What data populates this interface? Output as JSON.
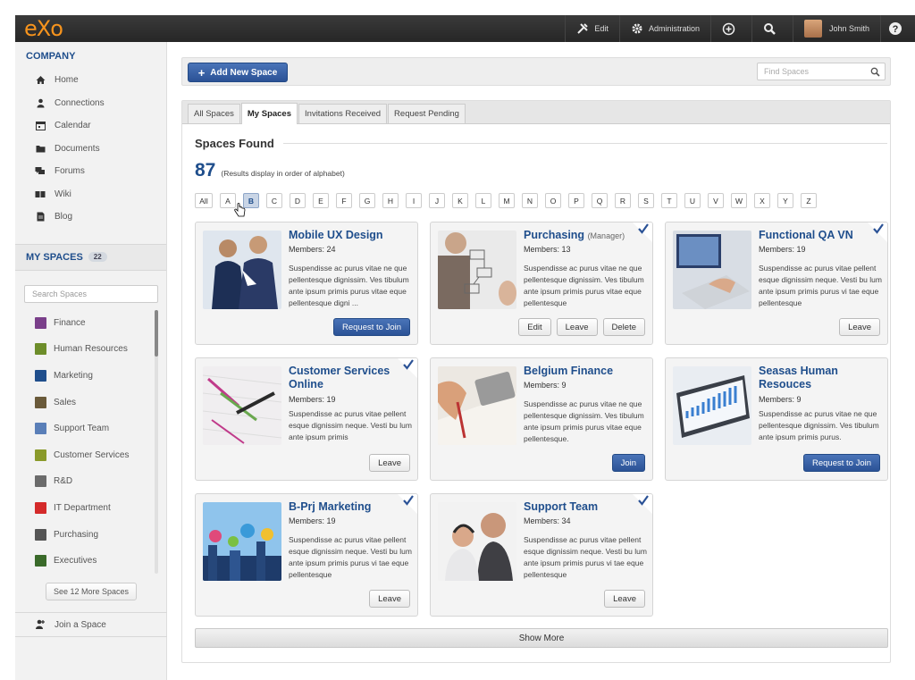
{
  "topbar": {
    "logo": "eXo",
    "edit_label": "Edit",
    "admin_label": "Administration",
    "user_name": "John Smith"
  },
  "sidebar": {
    "company_heading": "COMPANY",
    "nav_items": [
      {
        "label": "Home",
        "icon": "home-icon"
      },
      {
        "label": "Connections",
        "icon": "user-icon"
      },
      {
        "label": "Calendar",
        "icon": "calendar-icon"
      },
      {
        "label": "Documents",
        "icon": "folder-icon"
      },
      {
        "label": "Forums",
        "icon": "chat-icon"
      },
      {
        "label": "Wiki",
        "icon": "book-icon"
      },
      {
        "label": "Blog",
        "icon": "doc-icon"
      }
    ],
    "my_spaces_heading": "MY SPACES",
    "my_spaces_count": "22",
    "search_placeholder": "Search Spaces",
    "spaces": [
      {
        "label": "Finance",
        "color": "#7a3f8a"
      },
      {
        "label": "Human Resources",
        "color": "#6d8d2a"
      },
      {
        "label": "Marketing",
        "color": "#1f4e8c"
      },
      {
        "label": "Sales",
        "color": "#6a5a3a"
      },
      {
        "label": "Support Team",
        "color": "#5a7fb8"
      },
      {
        "label": "Customer Services",
        "color": "#8a9a2a"
      },
      {
        "label": "R&D",
        "color": "#6b6b6b"
      },
      {
        "label": "IT Department",
        "color": "#d42a2a"
      },
      {
        "label": "Purchasing",
        "color": "#555555"
      },
      {
        "label": "Executives",
        "color": "#3a6a2a"
      }
    ],
    "see_more_label": "See 12 More Spaces",
    "join_label": "Join a Space"
  },
  "actionbar": {
    "add_label": "Add New Space",
    "find_placeholder": "Find Spaces"
  },
  "tabs": [
    "All Spaces",
    "My Spaces",
    "Invitations Received",
    "Request Pending"
  ],
  "active_tab": "My Spaces",
  "found": {
    "heading": "Spaces Found",
    "count": "87",
    "note": "(Results display in order of alphabet)"
  },
  "letters": [
    "All",
    "A",
    "B",
    "C",
    "D",
    "E",
    "F",
    "G",
    "H",
    "I",
    "J",
    "K",
    "L",
    "M",
    "N",
    "O",
    "P",
    "Q",
    "R",
    "S",
    "T",
    "U",
    "V",
    "W",
    "X",
    "Y",
    "Z"
  ],
  "active_letter": "B",
  "cards": [
    {
      "title": "Mobile UX Design",
      "role": "",
      "members": "Members: 24",
      "desc": "Suspendisse ac purus vitae ne que pellentesque dignissim. Ves tibulum ante ipsum primis purus vitae eque pellentesque digni ...",
      "checked": false,
      "actions": [
        "Request to Join"
      ]
    },
    {
      "title": "Purchasing",
      "role": "(Manager)",
      "members": "Members: 13",
      "desc": "Suspendisse ac purus vitae ne que pellentesque dignissim. Ves tibulum ante ipsum primis purus vitae eque pellentesque",
      "checked": true,
      "actions": [
        "Edit",
        "Leave",
        "Delete"
      ]
    },
    {
      "title": "Functional QA VN",
      "role": "",
      "members": "Members: 19",
      "desc": "Suspendisse ac purus vitae pellent esque dignissim neque. Vesti bu lum ante ipsum primis purus vi tae eque pellentesque",
      "checked": true,
      "actions": [
        "Leave"
      ]
    },
    {
      "title": "Customer Services Online",
      "role": "",
      "members": "Members: 19",
      "desc": "Suspendisse ac purus vitae pellent esque dignissim neque. Vesti bu lum ante ipsum primis",
      "checked": true,
      "actions": [
        "Leave"
      ]
    },
    {
      "title": "Belgium Finance",
      "role": "",
      "members": "Members: 9",
      "desc": "Suspendisse ac purus vitae ne que pellentesque dignissim. Ves tibulum ante ipsum primis purus vitae eque pellentesque.",
      "checked": false,
      "actions": [
        "Join"
      ]
    },
    {
      "title": "Seasas Human Resouces",
      "role": "",
      "members": "Members: 9",
      "desc": "Suspendisse ac purus vitae ne que pellentesque dignissim. Ves tibulum ante ipsum primis purus.",
      "checked": false,
      "actions": [
        "Request to Join"
      ]
    },
    {
      "title": "B-Prj  Marketing",
      "role": "",
      "members": "Members: 19",
      "desc": "Suspendisse ac purus vitae pellent esque dignissim neque. Vesti bu lum ante ipsum primis purus vi tae eque pellentesque",
      "checked": true,
      "actions": [
        "Leave"
      ]
    },
    {
      "title": "Support Team",
      "role": "",
      "members": "Members: 34",
      "desc": "Suspendisse ac purus vitae pellent esque dignissim neque. Vesti bu lum ante ipsum primis purus vi tae eque pellentesque",
      "checked": true,
      "actions": [
        "Leave"
      ]
    }
  ],
  "show_more_label": "Show More"
}
